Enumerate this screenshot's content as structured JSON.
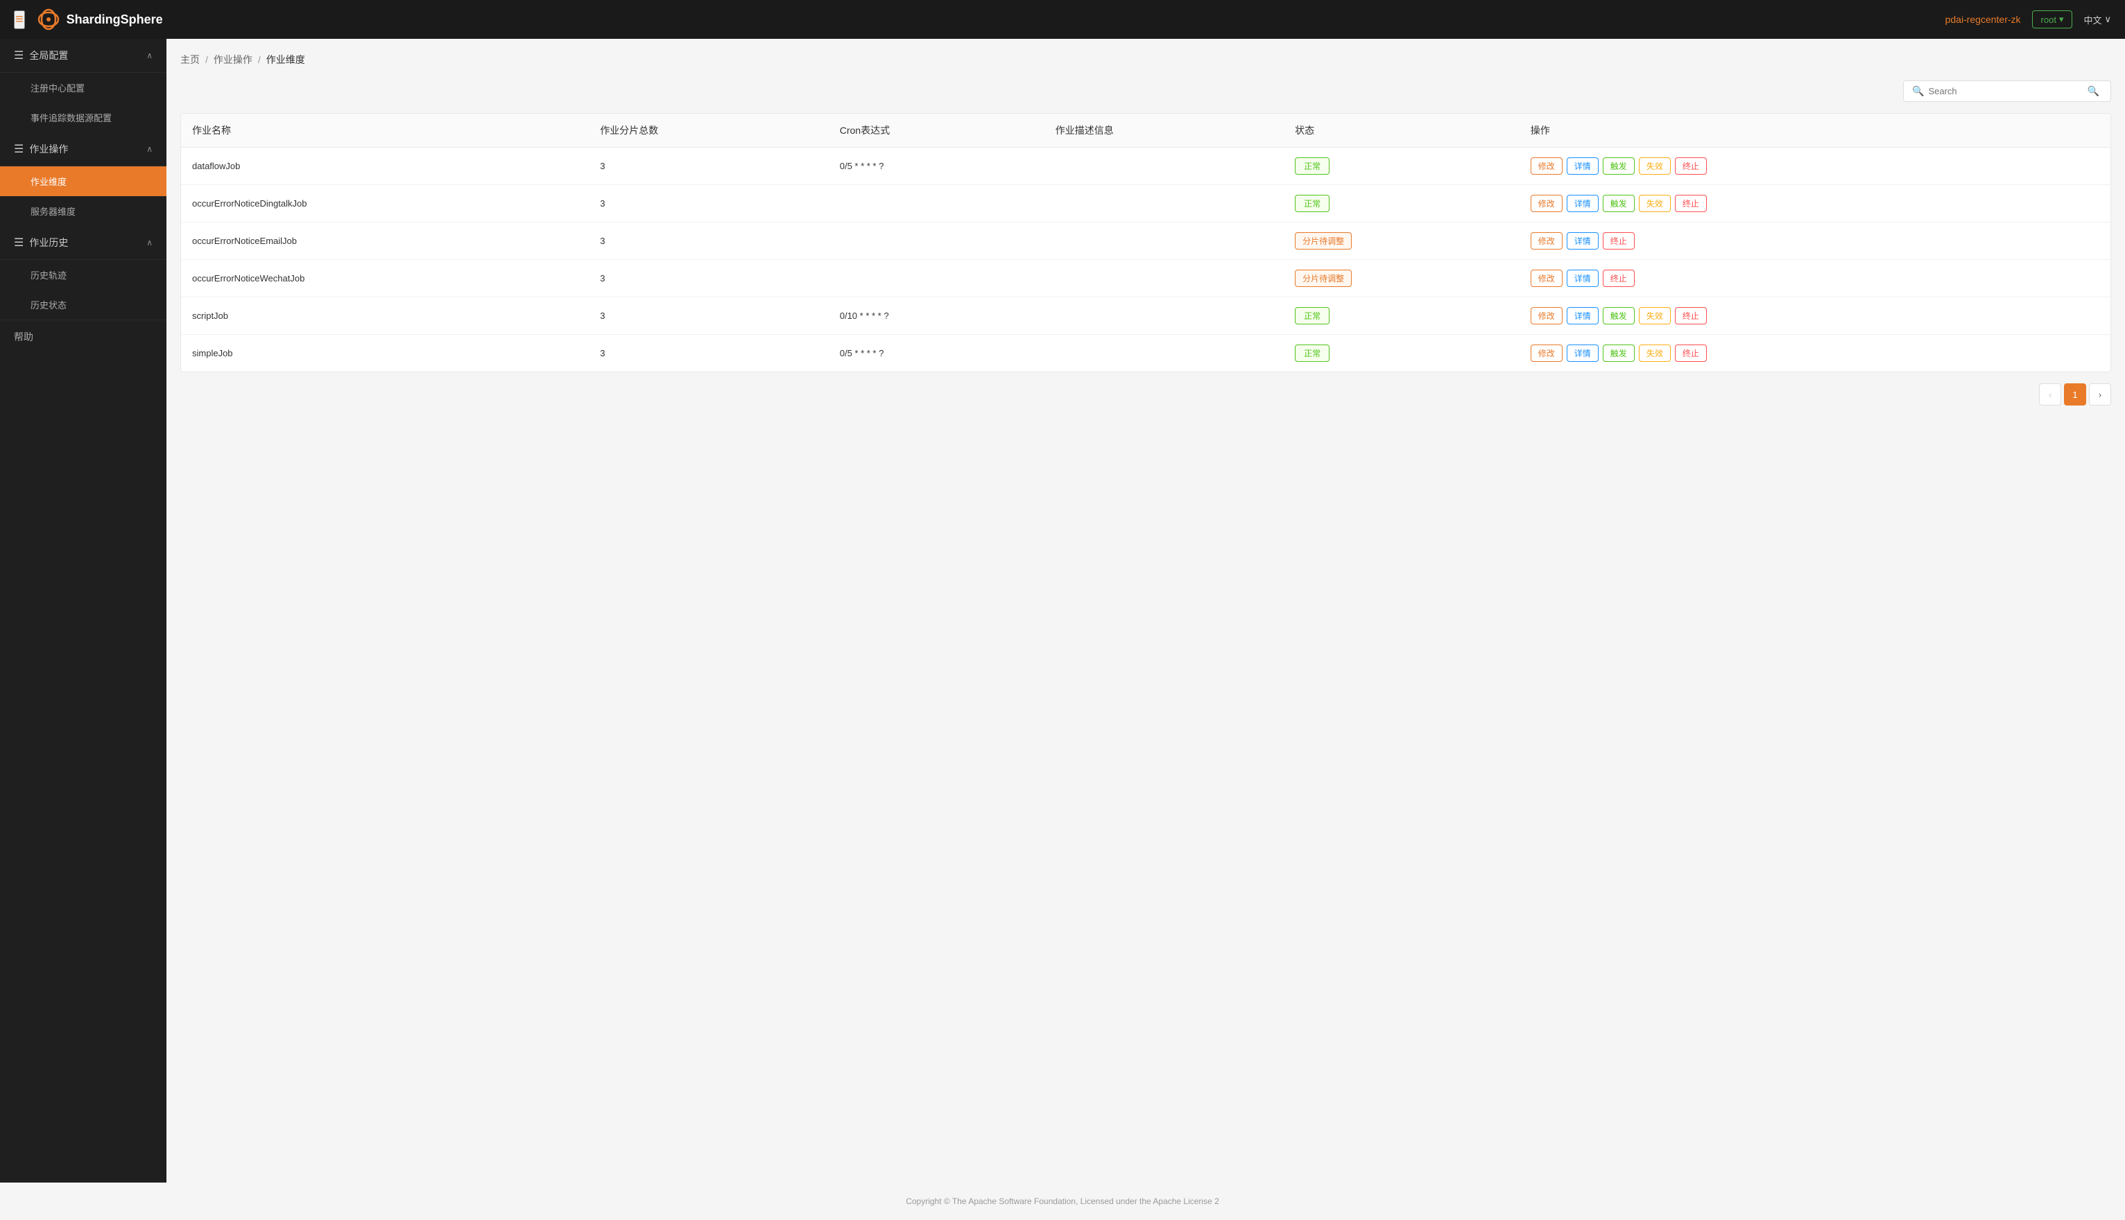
{
  "app": {
    "logo_text": "ShardingSphere",
    "menu_toggle_icon": "≡",
    "reg_center": "pdai-regcenter-zk",
    "user_label": "root",
    "user_chevron": "▾",
    "lang_label": "中文",
    "lang_chevron": "∨"
  },
  "sidebar": {
    "groups": [
      {
        "id": "global-config",
        "label": "全局配置",
        "expanded": true,
        "items": [
          {
            "id": "reg-center-config",
            "label": "注册中心配置",
            "active": false
          },
          {
            "id": "event-trace-config",
            "label": "事件追踪数据源配置",
            "active": false
          }
        ]
      },
      {
        "id": "job-ops",
        "label": "作业操作",
        "expanded": true,
        "items": [
          {
            "id": "job-dimension",
            "label": "作业维度",
            "active": true
          },
          {
            "id": "server-dimension",
            "label": "服务器维度",
            "active": false
          }
        ]
      },
      {
        "id": "job-history",
        "label": "作业历史",
        "expanded": true,
        "items": [
          {
            "id": "history-trace",
            "label": "历史轨迹",
            "active": false
          },
          {
            "id": "history-status",
            "label": "历史状态",
            "active": false
          }
        ]
      }
    ],
    "help_label": "帮助"
  },
  "breadcrumb": {
    "home": "主页",
    "sep1": "/",
    "level1": "作业操作",
    "sep2": "/",
    "current": "作业维度"
  },
  "search": {
    "placeholder": "Search"
  },
  "table": {
    "columns": [
      "作业名称",
      "作业分片总数",
      "Cron表达式",
      "作业描述信息",
      "状态",
      "操作"
    ],
    "rows": [
      {
        "name": "dataflowJob",
        "shards": "3",
        "cron": "0/5 * * * * ?",
        "desc": "",
        "status": "normal",
        "status_label": "正常",
        "actions": [
          "edit",
          "detail",
          "trigger",
          "fail",
          "stop"
        ]
      },
      {
        "name": "occurErrorNoticeDingtalkJob",
        "shards": "3",
        "cron": "",
        "desc": "",
        "status": "normal",
        "status_label": "正常",
        "actions": [
          "edit",
          "detail",
          "trigger",
          "fail",
          "stop"
        ]
      },
      {
        "name": "occurErrorNoticeEmailJob",
        "shards": "3",
        "cron": "",
        "desc": "",
        "status": "pending",
        "status_label": "分片待调整",
        "actions": [
          "edit",
          "detail",
          "stop"
        ]
      },
      {
        "name": "occurErrorNoticeWechatJob",
        "shards": "3",
        "cron": "",
        "desc": "",
        "status": "pending",
        "status_label": "分片待调整",
        "actions": [
          "edit",
          "detail",
          "stop"
        ]
      },
      {
        "name": "scriptJob",
        "shards": "3",
        "cron": "0/10 * * * * ?",
        "desc": "",
        "status": "normal",
        "status_label": "正常",
        "actions": [
          "edit",
          "detail",
          "trigger",
          "fail",
          "stop"
        ]
      },
      {
        "name": "simpleJob",
        "shards": "3",
        "cron": "0/5 * * * * ?",
        "desc": "",
        "status": "normal",
        "status_label": "正常",
        "actions": [
          "edit",
          "detail",
          "trigger",
          "fail",
          "stop"
        ]
      }
    ]
  },
  "actions": {
    "edit": "修改",
    "detail": "详情",
    "trigger": "触发",
    "fail": "失效",
    "stop": "终止"
  },
  "pagination": {
    "prev": "‹",
    "next": "›",
    "current_page": "1"
  },
  "footer": {
    "text": "Copyright © The Apache Software Foundation, Licensed under the Apache License 2"
  }
}
